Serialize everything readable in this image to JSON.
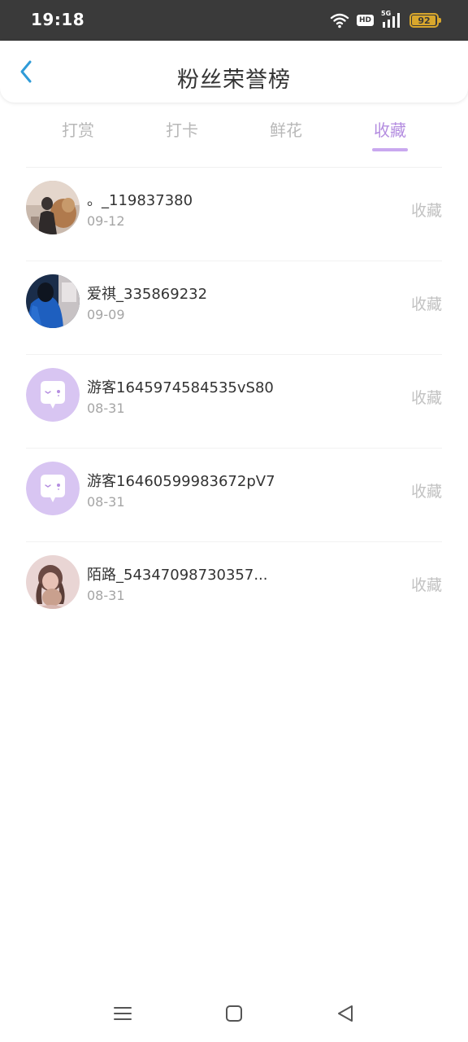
{
  "status_bar": {
    "time": "19:18",
    "hd_label": "HD",
    "signal_label": "5G",
    "battery": "92",
    "battery_level": 0.92,
    "battery_color": "#d9a72c"
  },
  "header": {
    "title": "粉丝荣誉榜",
    "back_icon": "chevron-left-icon"
  },
  "tabs": [
    {
      "label": "打赏",
      "active": false
    },
    {
      "label": "打卡",
      "active": false
    },
    {
      "label": "鲜花",
      "active": false
    },
    {
      "label": "收藏",
      "active": true
    }
  ],
  "accent_color": "#b48de0",
  "list": [
    {
      "name": "。_119837380",
      "date": "09-12",
      "action": "收藏",
      "avatar": "photo-avatar"
    },
    {
      "name": "爱祺_335869232",
      "date": "09-09",
      "action": "收藏",
      "avatar": "photo-avatar"
    },
    {
      "name": "游客1645974584535vS80",
      "date": "08-31",
      "action": "收藏",
      "avatar": "default-chat-avatar"
    },
    {
      "name": "游客16460599983672pV7",
      "date": "08-31",
      "action": "收藏",
      "avatar": "default-chat-avatar"
    },
    {
      "name": "陌路_54347098730357...",
      "date": "08-31",
      "action": "收藏",
      "avatar": "photo-avatar"
    }
  ],
  "nav_bar": {
    "icons": [
      "menu-icon",
      "home-icon",
      "back-icon"
    ]
  }
}
